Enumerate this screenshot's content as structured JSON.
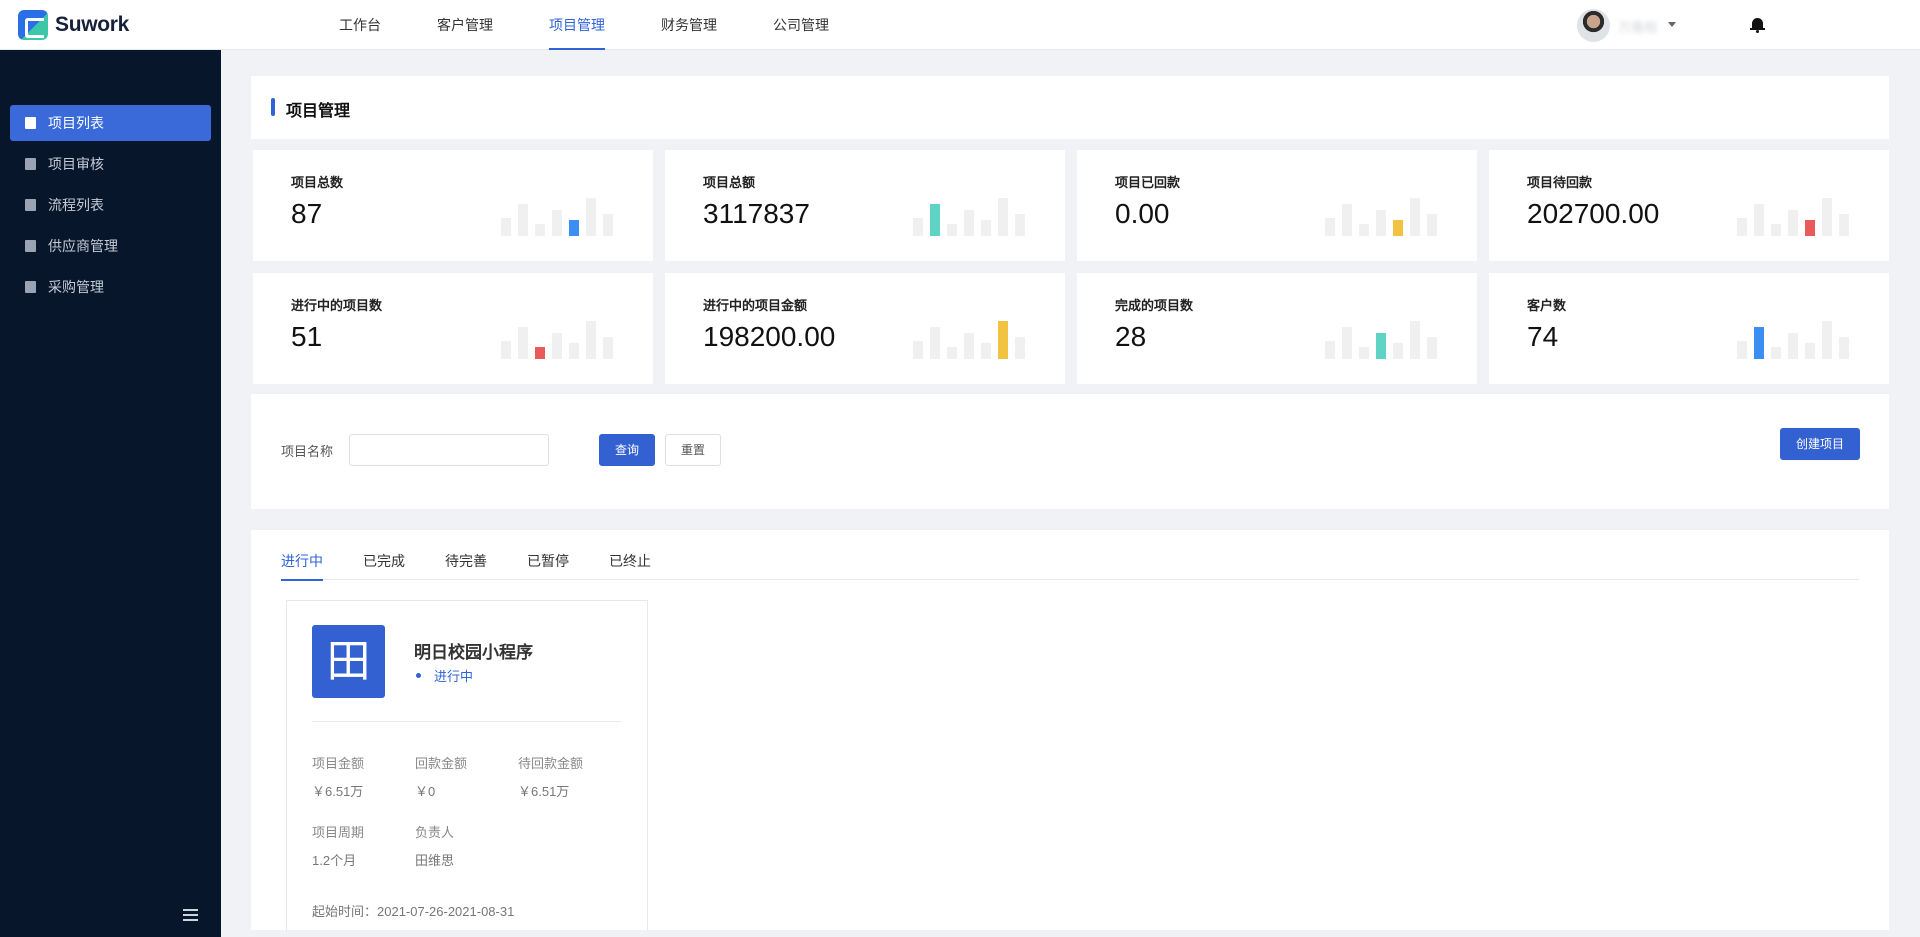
{
  "brand": {
    "name": "Suwork"
  },
  "topnav": [
    {
      "label": "工作台",
      "active": false
    },
    {
      "label": "客户管理",
      "active": false
    },
    {
      "label": "项目管理",
      "active": true
    },
    {
      "label": "财务管理",
      "active": false
    },
    {
      "label": "公司管理",
      "active": false
    }
  ],
  "user": {
    "name": "万雅相",
    "avatar_icon": "avatar-icon"
  },
  "sidebar": {
    "items": [
      {
        "label": "项目列表",
        "icon": "document-icon",
        "active": true
      },
      {
        "label": "项目审核",
        "icon": "audit-icon",
        "active": false
      },
      {
        "label": "流程列表",
        "icon": "flow-icon",
        "active": false
      },
      {
        "label": "供应商管理",
        "icon": "supplier-icon",
        "active": false
      },
      {
        "label": "采购管理",
        "icon": "purchase-icon",
        "active": false
      }
    ]
  },
  "page": {
    "title": "项目管理"
  },
  "stats": [
    {
      "label": "项目总数",
      "value": "87",
      "highlight_index": 4,
      "color": "#3b8ff3"
    },
    {
      "label": "项目总额",
      "value": "3117837",
      "highlight_index": 1,
      "color": "#5fd3c6"
    },
    {
      "label": "项目已回款",
      "value": "0.00",
      "highlight_index": 4,
      "color": "#f2c241"
    },
    {
      "label": "项目待回款",
      "value": "202700.00",
      "highlight_index": 4,
      "color": "#e95a5a"
    },
    {
      "label": "进行中的项目数",
      "value": "51",
      "highlight_index": 2,
      "color": "#e95a5a"
    },
    {
      "label": "进行中的项目金额",
      "value": "198200.00",
      "highlight_index": 5,
      "color": "#f2c241"
    },
    {
      "label": "完成的项目数",
      "value": "28",
      "highlight_index": 3,
      "color": "#5fd3c6"
    },
    {
      "label": "客户数",
      "value": "74",
      "highlight_index": 1,
      "color": "#3b8ff3"
    }
  ],
  "search": {
    "label": "项目名称",
    "value": "",
    "placeholder": "",
    "query_label": "查询",
    "reset_label": "重置",
    "create_label": "创建项目"
  },
  "tabs": [
    {
      "label": "进行中",
      "active": true
    },
    {
      "label": "已完成",
      "active": false
    },
    {
      "label": "待完善",
      "active": false
    },
    {
      "label": "已暂停",
      "active": false
    },
    {
      "label": "已终止",
      "active": false
    }
  ],
  "project": {
    "icon_glyph": "田",
    "name": "明日校园小程序",
    "status": "进行中",
    "amount_label": "项目金额",
    "amount": "￥6.51万",
    "received_label": "回款金额",
    "received": "￥0",
    "pending_label": "待回款金额",
    "pending": "￥6.51万",
    "period_label": "项目周期",
    "period": "1.2个月",
    "owner_label": "负责人",
    "owner": "田维思",
    "date_text": "起始时间：2021-07-26-2021-08-31"
  },
  "colors": {
    "primary": "#3461d1",
    "sidebar_bg": "#08162c",
    "page_bg": "#f0f2f5",
    "bar_muted": "#f0f0f0"
  }
}
